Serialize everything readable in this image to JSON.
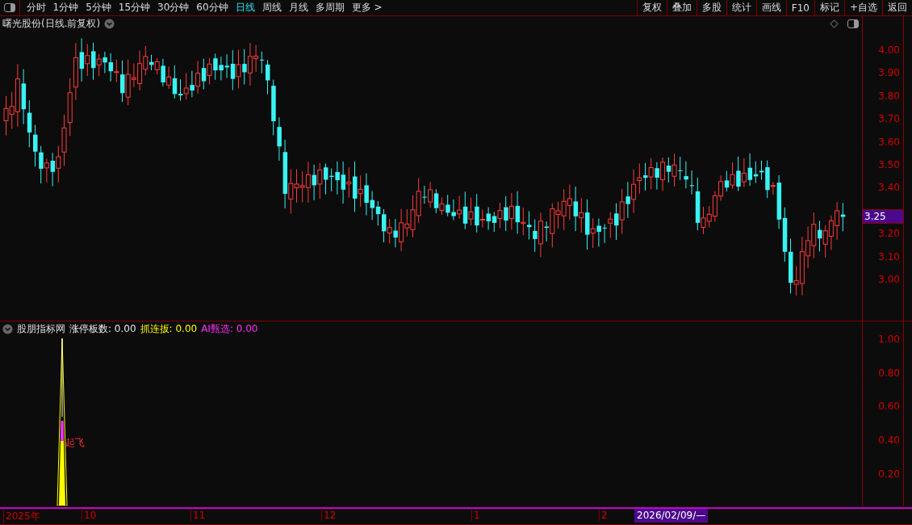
{
  "periods": [
    {
      "label": "分时",
      "selected": false
    },
    {
      "label": "1分钟",
      "selected": false
    },
    {
      "label": "5分钟",
      "selected": false
    },
    {
      "label": "15分钟",
      "selected": false
    },
    {
      "label": "30分钟",
      "selected": false
    },
    {
      "label": "60分钟",
      "selected": false
    },
    {
      "label": "日线",
      "selected": true
    },
    {
      "label": "周线",
      "selected": false
    },
    {
      "label": "月线",
      "selected": false
    },
    {
      "label": "多周期",
      "selected": false
    },
    {
      "label": "更多 >",
      "selected": false
    }
  ],
  "tools": [
    "复权",
    "叠加",
    "多股",
    "统计",
    "画线",
    "F10",
    "标记",
    "+自选",
    "返回"
  ],
  "main_chart": {
    "title": "曙光股份(日线.前复权)",
    "price_axis": [
      {
        "kind": "tick",
        "label": "4.00"
      },
      {
        "kind": "tick",
        "label": "3.90"
      },
      {
        "kind": "tick",
        "label": "3.80"
      },
      {
        "kind": "tick",
        "label": "3.70"
      },
      {
        "kind": "tick",
        "label": "3.60"
      },
      {
        "kind": "tick",
        "label": "3.50"
      },
      {
        "kind": "tick",
        "label": "3.40"
      },
      {
        "kind": "current",
        "label": "3.25"
      },
      {
        "kind": "tick",
        "label": "3.20"
      },
      {
        "kind": "tick",
        "label": "3.10"
      },
      {
        "kind": "tick",
        "label": "3.00"
      }
    ]
  },
  "indicator": {
    "title": "股朋指标网",
    "readings": [
      {
        "label": "涨停板数:",
        "value": "0.00",
        "color": "#e6e6e6"
      },
      {
        "label": "抓连扳:",
        "value": "0.00",
        "color": "#ffff00"
      },
      {
        "label": "AI甄选:",
        "value": "0.00",
        "color": "#ff33ff"
      }
    ],
    "signal": "起飞",
    "ticks": [
      "1.00",
      "0.80",
      "0.60",
      "0.40",
      "0.20"
    ]
  },
  "time_axis": {
    "labels": [
      "2025年",
      "10",
      "11",
      "12",
      "1",
      "2"
    ],
    "cursor_date": "2026/02/09/—"
  }
}
